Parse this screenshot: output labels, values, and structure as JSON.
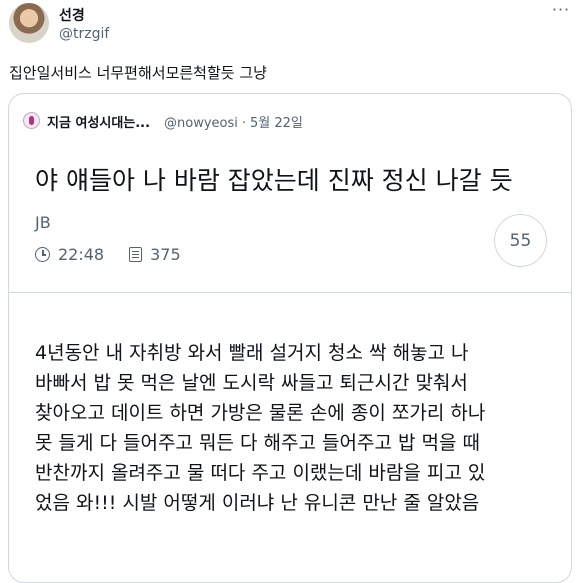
{
  "tweet": {
    "author_name": "선경",
    "author_handle": "@trzgif",
    "more_icon": "more-horizontal-icon",
    "text": "집안일서비스 너무편해서모른척할듯 그냥"
  },
  "quote": {
    "author_name": "지금 여성시대는...",
    "author_handle": "@nowyeosi",
    "separator": "·",
    "date": "5월 22일",
    "headline": "야 얘들아 나 바람 잡았는데 진짜 정신 나갈 듯",
    "author_label": "JB",
    "time": "22:48",
    "view_count": "375",
    "comment_count": "55",
    "body_lines": [
      "4년동안 내 자취방 와서 빨래 설거지 청소 싹 해놓고 나",
      "바빠서 밥 못 먹은 날엔 도시락 싸들고 퇴근시간 맞춰서",
      "찾아오고 데이트 하면 가방은 물론 손에 종이 쪼가리 하나",
      "못 들게 다 들어주고 뭐든 다 해주고 들어주고 밥 먹을 때",
      "반찬까지 올려주고 물 떠다 주고 이랬는데 바람을 피고 있",
      "었음 와!!! 시발 어떻게 이러냐 난 유니콘 만난 줄 알았음"
    ]
  }
}
